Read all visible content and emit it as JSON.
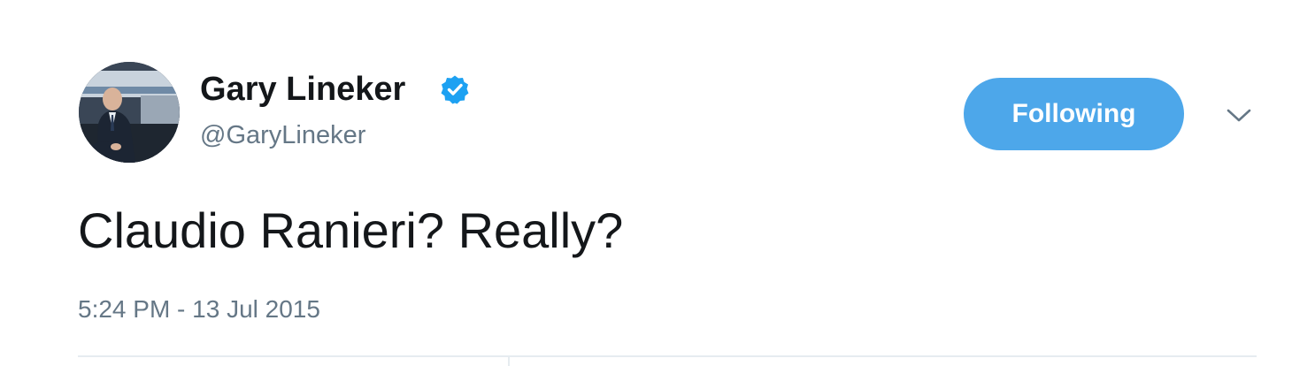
{
  "tweet": {
    "author": {
      "display_name": "Gary Lineker",
      "handle": "@GaryLineker",
      "verified": true,
      "avatar_icon": "profile-photo"
    },
    "follow_button_label": "Following",
    "menu_icon": "chevron-down-icon",
    "text": "Claudio Ranieri? Really?",
    "timestamp": "5:24 PM - 13 Jul 2015"
  },
  "colors": {
    "accent": "#4da7ea",
    "verified_badge": "#1da1f2",
    "primary_text": "#14171a",
    "secondary_text": "#657786",
    "divider": "#e6ecf0"
  }
}
